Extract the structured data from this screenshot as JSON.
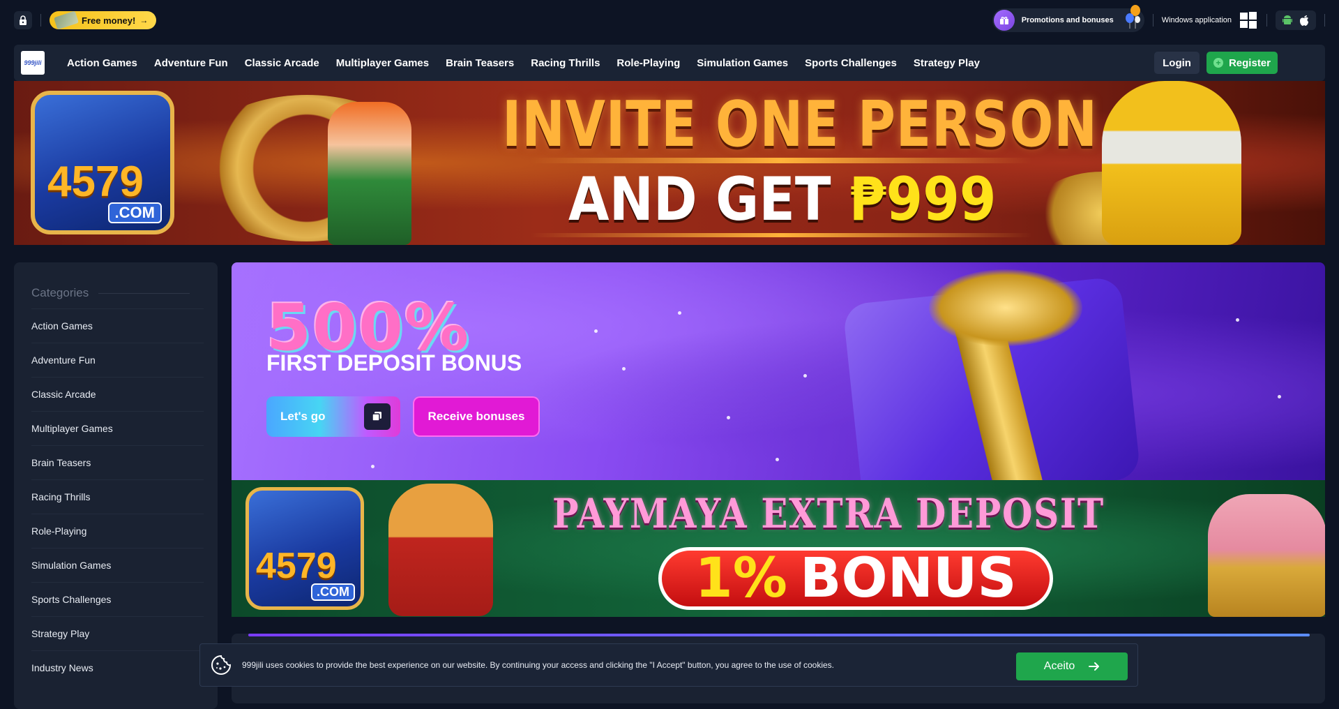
{
  "topbar": {
    "free_money": "Free money!",
    "promotions": "Promotions and bonuses",
    "windows_app": "Windows application"
  },
  "nav": {
    "logo_text": "999jili",
    "links": [
      "Action Games",
      "Adventure Fun",
      "Classic Arcade",
      "Multiplayer Games",
      "Brain Teasers",
      "Racing Thrills",
      "Role-Playing",
      "Simulation Games",
      "Sports Challenges",
      "Strategy Play"
    ],
    "login": "Login",
    "register": "Register"
  },
  "hero_banner": {
    "line1": "INVITE ONE PERSON",
    "line2_prefix": "AND GET",
    "line2_amount": "₱999",
    "tile_number": "4579",
    "tile_com": ".COM"
  },
  "sidebar": {
    "title": "Categories",
    "items": [
      "Action Games",
      "Adventure Fun",
      "Classic Arcade",
      "Multiplayer Games",
      "Brain Teasers",
      "Racing Thrills",
      "Role-Playing",
      "Simulation Games",
      "Sports Challenges",
      "Strategy Play",
      "Industry News"
    ]
  },
  "promo": {
    "percent": "500%",
    "subtitle": "FIRST DEPOSIT BONUS",
    "lets_go": "Let's go",
    "receive": "Receive bonuses"
  },
  "paymaya_banner": {
    "title": "PAYMAYA EXTRA DEPOSIT",
    "bonus_pct": "1%",
    "bonus_word": "BONUS",
    "tile_number": "4579",
    "tile_com": ".COM"
  },
  "cookie": {
    "message": "999jili uses cookies to provide the best experience on our website. By continuing your access and clicking the \"I Accept\" button, you agree to the use of cookies.",
    "accept": "Aceito"
  },
  "colors": {
    "page_bg": "#0d1424",
    "panel_bg": "#1a2232",
    "accent_green": "#1fa64c",
    "accent_magenta": "#e11ad5",
    "accent_yellow": "#f6c21b"
  }
}
